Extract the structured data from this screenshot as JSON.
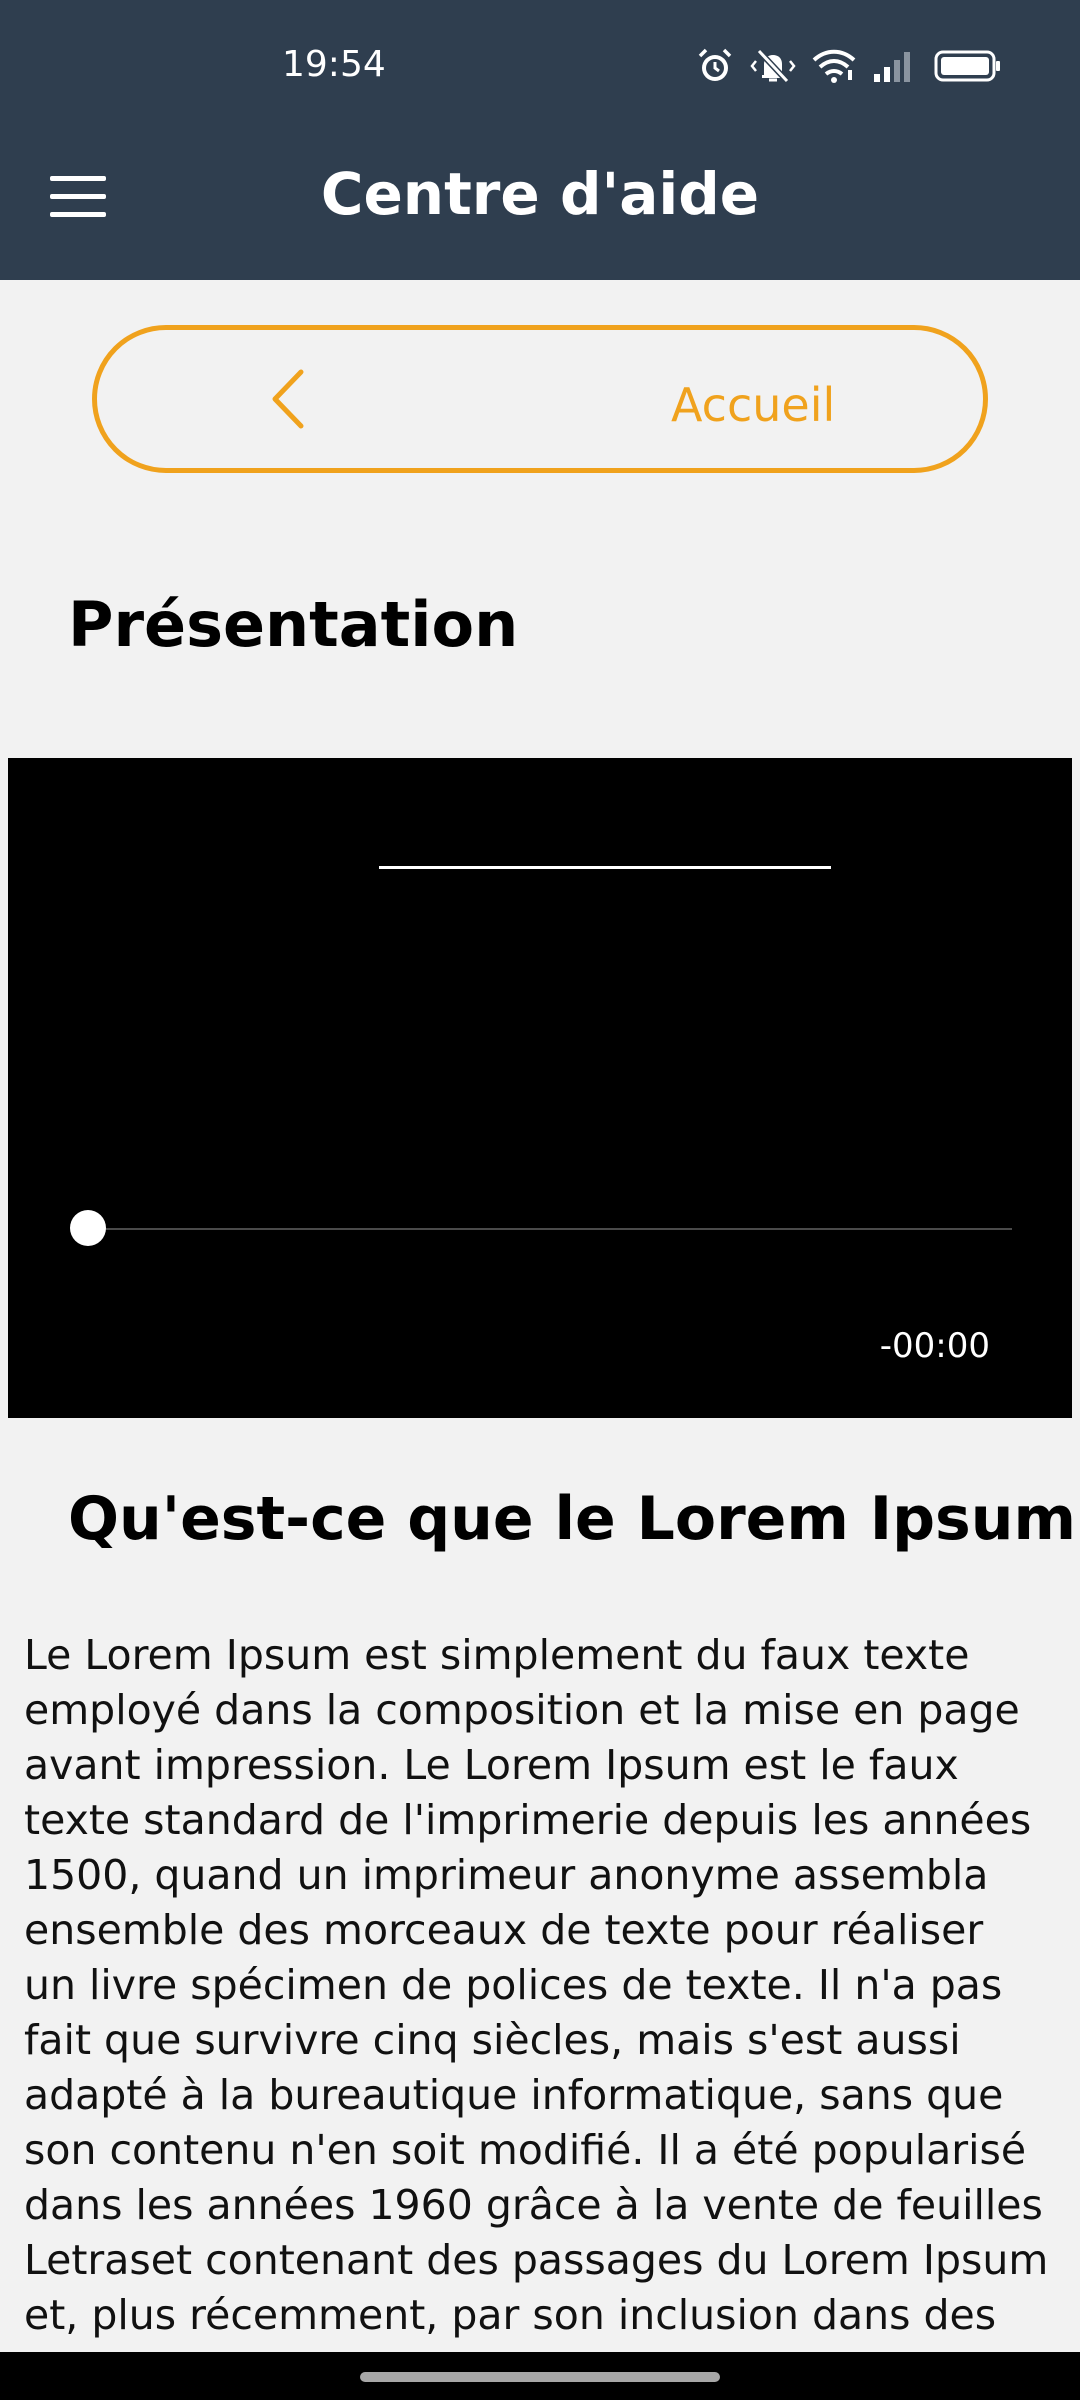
{
  "status_bar": {
    "time": "19:54",
    "icons": [
      "alarm-icon",
      "vibrate-off-icon",
      "wifi-icon",
      "signal-icon",
      "battery-icon"
    ]
  },
  "header": {
    "title": "Centre d'aide",
    "menu_icon": "hamburger-menu-icon"
  },
  "home_button": {
    "label": "Accueil",
    "icon": "chevron-left-icon"
  },
  "section": {
    "title": "Présentation"
  },
  "video": {
    "time_remaining": "-00:00",
    "progress": 0
  },
  "article": {
    "title": "Qu'est-ce que le Lorem Ipsum?",
    "lines": [
      "Le Lorem Ipsum est simplement du faux texte",
      "employé dans la composition et la mise en page",
      "avant impression. Le Lorem Ipsum est le faux",
      "texte standard de l'imprimerie depuis les années",
      "1500, quand un imprimeur anonyme assembla",
      "ensemble des morceaux de texte pour réaliser",
      "un livre spécimen de polices de texte. Il n'a pas",
      "fait que survivre cinq siècles, mais s'est aussi",
      "adapté à la bureautique informatique, sans que",
      "son contenu n'en soit modifié. Il a été popularisé",
      "dans les années 1960 grâce à la vente de feuilles",
      "Letraset contenant des passages du Lorem Ipsum",
      "et, plus récemment, par son inclusion dans des"
    ]
  },
  "colors": {
    "header_bg": "#2f3e4f",
    "accent": "#f0a21d",
    "page_bg": "#f2f2f2",
    "video_bg": "#000000"
  }
}
